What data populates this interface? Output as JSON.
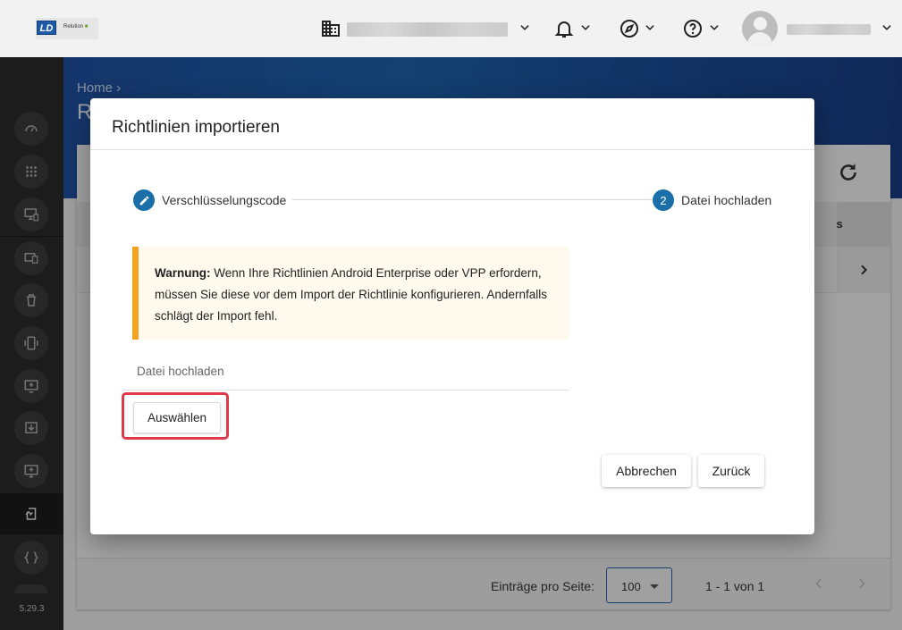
{
  "app": {
    "logo_text": "LD",
    "logo_subtext": "Relution"
  },
  "sidebar": {
    "version": "5.29.3",
    "icons": [
      "dashboard-icon",
      "apps-icon",
      "devices-icon",
      "device-groups-icon",
      "trash-icon",
      "phone-icon",
      "enroll-icon",
      "download-icon",
      "desktop-icon",
      "policy-import-icon",
      "code-icon"
    ]
  },
  "page": {
    "breadcrumb": "Home",
    "title_initial": "R",
    "column_header_stub": "tbas"
  },
  "footer": {
    "entries_label": "Einträge pro Seite:",
    "page_size": "100",
    "range": "1 - 1 von 1"
  },
  "dialog": {
    "title": "Richtlinien importieren",
    "steps": [
      {
        "label": "Verschlüsselungscode",
        "state": "edit-done"
      },
      {
        "number": "2",
        "label": "Datei hochladen",
        "state": "active"
      }
    ],
    "warning": {
      "bold": "Warnung:",
      "text": " Wenn Ihre Richtlinien Android Enterprise oder VPP erfordern, müssen Sie diese vor dem Import der Richtlinie konfigurieren. Andernfalls schlägt der Import fehl."
    },
    "upload_label": "Datei hochladen",
    "choose_button": "Auswählen",
    "cancel_button": "Abbrechen",
    "back_button": "Zurück"
  },
  "colors": {
    "accent": "#1a6fa8",
    "warning_border": "#f3a321",
    "highlight": "#e0394b"
  }
}
